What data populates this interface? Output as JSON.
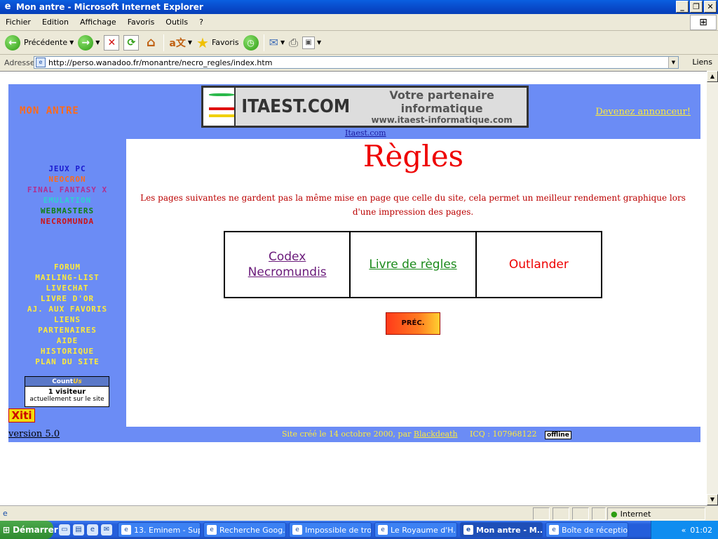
{
  "window": {
    "title": "Mon antre - Microsoft Internet Explorer"
  },
  "menu": [
    "Fichier",
    "Edition",
    "Affichage",
    "Favoris",
    "Outils",
    "?"
  ],
  "toolbar": {
    "back_label": "Précédente",
    "favorites_label": "Favoris"
  },
  "address": {
    "label": "Adresse",
    "url": "http://perso.wanadoo.fr/monantre/necro_regles/index.htm",
    "links_label": "Liens"
  },
  "site": {
    "name": "MON ANTRE",
    "banner": {
      "brand": "ITAEST.COM",
      "tagline": "Votre partenaire informatique",
      "url": "www.itaest-informatique.com",
      "caption": "Itaest.com"
    },
    "advertise": "Devenez annonceur!",
    "nav_games": [
      {
        "label": "JEUX PC",
        "color": "#1a1ad0"
      },
      {
        "label": "NEOCRON",
        "color": "#ff6a1a"
      },
      {
        "label": "FINAL FANTASY X",
        "color": "#b03090"
      },
      {
        "label": "EMULATION",
        "color": "#30d0d0"
      },
      {
        "label": "WEBMASTERS",
        "color": "#108010"
      },
      {
        "label": "NECROMUNDA",
        "color": "#d01010"
      }
    ],
    "nav_site": [
      "FORUM",
      "MAILING-LIST",
      "LIVECHAT",
      "LIVRE D'OR",
      "AJ. AUX FAVORIS",
      "LIENS",
      "PARTENAIRES",
      "AIDE",
      "HISTORIQUE",
      "PLAN DU SITE"
    ],
    "counter": {
      "brand_a": "Count",
      "brand_b": "Us",
      "visitors": "1 visiteur",
      "sub": "actuellement sur le site"
    },
    "xiti": "Xiti",
    "version": "version 5.0",
    "footer": {
      "created": "Site créé  le 14 octobre 2000, par",
      "author": "Blackdeath",
      "icq": "ICQ : 107968122",
      "status": "offline"
    }
  },
  "content": {
    "heading": "Règles",
    "intro": "Les pages suivantes ne gardent pas la même mise en page que celle du site, cela permet un meilleur rendement graphique lors d'une impression des pages.",
    "links": [
      "Codex Necromundis",
      "Livre de règles",
      "Outlander"
    ],
    "prev_button": "PRÉC."
  },
  "status": {
    "zone": "Internet"
  },
  "taskbar": {
    "start": "Démarrer",
    "tasks": [
      "13. Eminem - Sup...",
      "Recherche Goog...",
      "Impossible de tro...",
      "Le Royaume d'H...",
      "Mon antre - M...",
      "Boîte de réceptio..."
    ],
    "active_index": 4,
    "clock": "01:02"
  }
}
